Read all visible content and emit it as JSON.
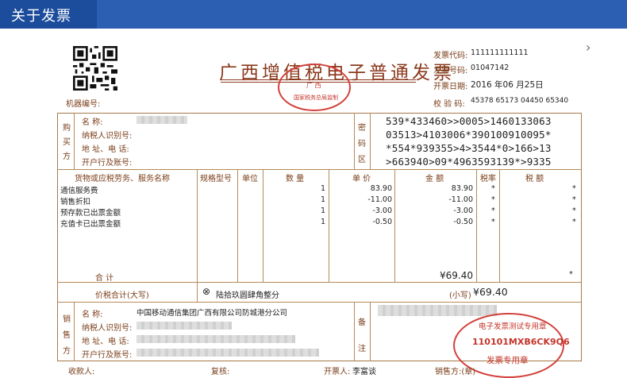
{
  "header": {
    "title": "关于发票"
  },
  "invoice": {
    "title": "广西增值税电子普通发票",
    "seal_inner": "广 西",
    "seal_bottom": "国家税务总局监制",
    "machine_no_label": "机器编号:",
    "meta": {
      "code_label": "发票代码:",
      "code_value": "111111111111",
      "number_label": "发票号码:",
      "number_value": "01047142",
      "date_label": "开票日期:",
      "date_value": "2016 年06 月25日",
      "check_label": "校  验  码:",
      "check_value": "45378 65173 04450 65340"
    },
    "buyer": {
      "side_label": [
        "购",
        "买",
        "方"
      ],
      "name_label": "名          称:",
      "tax_label": "纳税人识别号:",
      "addr_label": "地  址、电  话:",
      "bank_label": "开户行及账号:"
    },
    "cipher": {
      "side_label": [
        "密",
        "码",
        "区"
      ],
      "lines": [
        "539*433460>>0005>1460133063",
        "03513>4103006*390100910095*",
        "*554*939355>4>3544*0>166>13",
        ">663940>09*4963593139*>9335"
      ]
    },
    "items_header": {
      "name": "货物或应税劳务、服务名称",
      "spec": "规格型号",
      "unit": "单位",
      "qty": "数  量",
      "price": "单  价",
      "amount": "金    额",
      "rate": "税率",
      "tax": "税    额"
    },
    "items": [
      {
        "name": "通信服务费",
        "qty": "1",
        "price": "83.90",
        "amount": "83.90",
        "rate": "*",
        "tax": "*"
      },
      {
        "name": "销售折扣",
        "qty": "1",
        "price": "-11.00",
        "amount": "-11.00",
        "rate": "*",
        "tax": "*"
      },
      {
        "name": "预存款已出票金额",
        "qty": "1",
        "price": "-3.00",
        "amount": "-3.00",
        "rate": "*",
        "tax": "*"
      },
      {
        "name": "充值卡已出票金额",
        "qty": "1",
        "price": "-0.50",
        "amount": "-0.50",
        "rate": "*",
        "tax": "*"
      }
    ],
    "total": {
      "label": "合          计",
      "amount": "¥69.40",
      "tax": "*"
    },
    "total_words": {
      "label": "价税合计(大写)",
      "symbol": "⊗",
      "words": "陆拾玖圆肆角整分",
      "small_label": "(小写)",
      "small_value": "¥69.40"
    },
    "seller": {
      "side_label": [
        "销",
        "售",
        "方"
      ],
      "name_label": "名          称:",
      "name_value": "中国移动通信集团广西有限公司防城港分公司",
      "tax_label": "纳税人识别号:",
      "addr_label": "地  址、电  话:",
      "bank_label": "开户行及账号:"
    },
    "remark": {
      "side_label": [
        "备",
        "注"
      ]
    },
    "stamp": {
      "outer": "电子发票测试专用章",
      "code": "110101MXB6CK9Q6",
      "bottom": "发票专用章"
    },
    "footer": {
      "payee": "收款人:",
      "reviewer": "复核:",
      "drawer_label": "开票人:",
      "drawer_value": "李富谈",
      "seller_label": "销售方:(章)"
    }
  }
}
